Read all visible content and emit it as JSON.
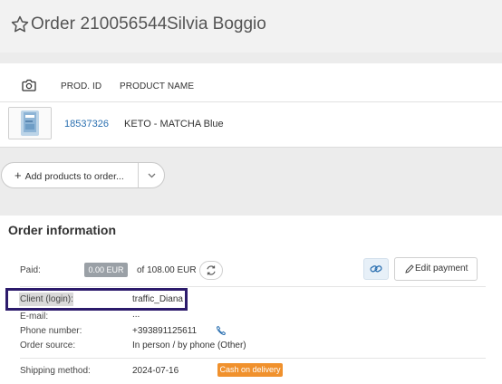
{
  "header": {
    "order_title": "Order 210056544",
    "customer_name": "Silvia Boggio",
    "star_icon": "star-outline-icon"
  },
  "products_table": {
    "photo_icon": "camera-icon",
    "columns": [
      "PROD. ID",
      "PRODUCT NAME"
    ],
    "rows": [
      {
        "prod_id": "18537326",
        "product_name": "KETO - MATCHA Blue"
      }
    ]
  },
  "add_products": {
    "label": "Add products to order...",
    "plus_icon": "plus-icon",
    "caret_icon": "chevron-down-icon"
  },
  "order_info": {
    "title": "Order information",
    "paid_label": "Paid:",
    "paid_amount": "0.00 EUR",
    "paid_of": "of 108.00 EUR",
    "edit_payment": "Edit payment",
    "client_label": "Client (login):",
    "client_value": "traffic_Diana",
    "email_label": "E-mail:",
    "email_value": "...",
    "phone_label": "Phone number:",
    "phone_value": "+393891125611",
    "source_label": "Order source:",
    "source_value": "In person / by phone (Other)",
    "shipping_label": "Shipping method:",
    "shipping_value": "2024-07-16",
    "payment_badge": "Cash on delivery"
  },
  "colors": {
    "accent_link": "#2a6fb0",
    "badge_grey": "#9aa0a6",
    "badge_orange": "#f0912d",
    "highlight_box": "#2c1b6b"
  }
}
